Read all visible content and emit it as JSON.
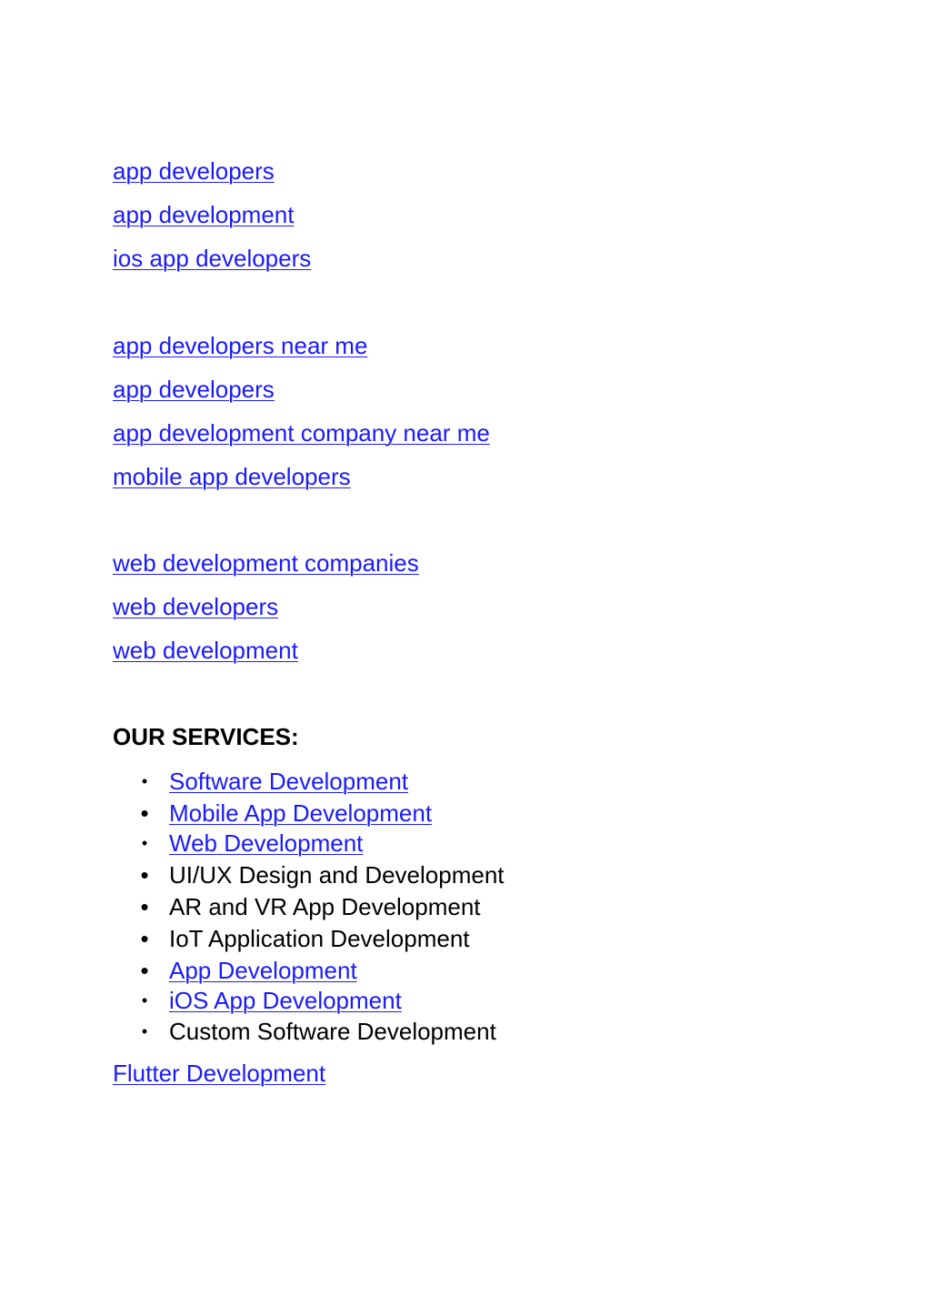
{
  "group_1": [
    {
      "label": "app developers"
    },
    {
      "label": "app development"
    },
    {
      "label": "ios app developers"
    }
  ],
  "group_2": [
    {
      "label": "app developers near me"
    },
    {
      "label": "app developers"
    },
    {
      "label": "app development company near me"
    },
    {
      "label": "mobile app developers"
    }
  ],
  "group_3": [
    {
      "label": "web development companies"
    },
    {
      "label": "web developers"
    },
    {
      "label": "web development"
    }
  ],
  "services_heading": "OUR SERVICES:",
  "services": [
    {
      "label": "Software Development",
      "link": true,
      "bullet": "•"
    },
    {
      "label": "Mobile App Development",
      "link": true,
      "bullet": "•"
    },
    {
      "label": "Web Development",
      "link": true,
      "bullet": "•"
    },
    {
      "label": "UI/UX Design and Development",
      "link": false,
      "bullet": "•"
    },
    {
      "label": "AR and VR App Development",
      "link": false,
      "bullet": "•"
    },
    {
      "label": "IoT Application Development",
      "link": false,
      "bullet": "•"
    },
    {
      "label": "App Development",
      "link": true,
      "bullet": "•"
    },
    {
      "label": "iOS App Development",
      "link": true,
      "bullet": "•"
    },
    {
      "label": "Custom Software Development",
      "link": false,
      "bullet": "•"
    }
  ],
  "footer_link": "Flutter Development",
  "colors": {
    "link": "#1a1aff",
    "text": "#000000",
    "background": "#ffffff"
  }
}
